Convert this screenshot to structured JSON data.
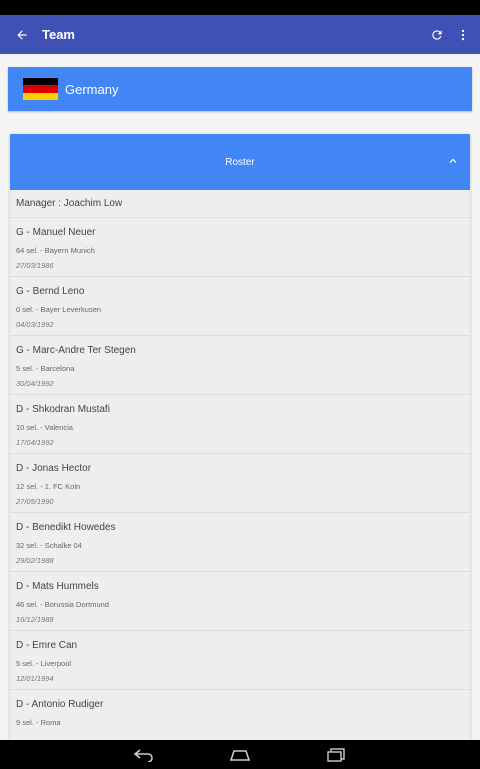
{
  "app_bar": {
    "title": "Team",
    "back_icon": "arrow-left-icon",
    "refresh_icon": "refresh-icon",
    "menu_icon": "more-vertical-icon"
  },
  "country": {
    "name": "Germany",
    "flag_colors": [
      "#000000",
      "#dd0000",
      "#ffce00"
    ]
  },
  "roster": {
    "title": "Roster",
    "manager": "Manager : Joachim Low",
    "players": [
      {
        "name": "G - Manuel Neuer",
        "club": "64 sel. - Bayern Munich",
        "dob": "27/03/1986"
      },
      {
        "name": "G - Bernd Leno",
        "club": "0 sel. - Bayer Leverkusen",
        "dob": "04/03/1992"
      },
      {
        "name": "G - Marc-Andre Ter Stegen",
        "club": "5 sel. - Barcelona",
        "dob": "30/04/1992"
      },
      {
        "name": "D - Shkodran Mustafi",
        "club": "10 sel. - Valencia",
        "dob": "17/04/1992"
      },
      {
        "name": "D - Jonas Hector",
        "club": "12 sel. - 1. FC Koln",
        "dob": "27/05/1990"
      },
      {
        "name": "D - Benedikt Howedes",
        "club": "32 sel. - Schalke 04",
        "dob": "29/02/1988"
      },
      {
        "name": "D - Mats Hummels",
        "club": "46 sel. - Borussia Dortmund",
        "dob": "16/12/1988"
      },
      {
        "name": "D - Emre Can",
        "club": "5 sel. - Liverpool",
        "dob": "12/01/1994"
      },
      {
        "name": "D - Antonio Rudiger",
        "club": "9 sel. - Roma",
        "dob": ""
      }
    ]
  },
  "colors": {
    "app_bar": "#3f51b5",
    "accent": "#4285f4"
  }
}
